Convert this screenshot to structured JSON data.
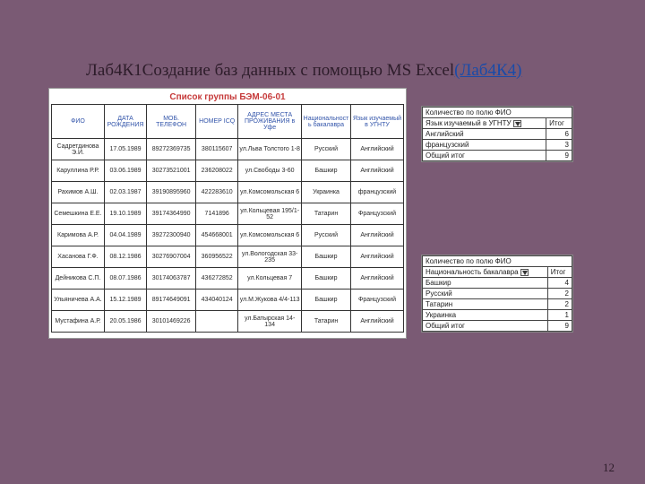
{
  "title": {
    "prefix": "Лаб4К1Создание баз данных с помощью MS Excel",
    "link": "(Лаб4К4)"
  },
  "list_title": "Список группы БЭМ-06-01",
  "main_headers": [
    "ФИО",
    "ДАТА РОЖДЕНИЯ",
    "МОБ. ТЕЛЕФОН",
    "НОМЕР ICQ",
    "АДРЕС МЕСТА ПРОЖИВАНИЯ в Уфе",
    "Национальность бакалавра",
    "Язык изучаемый в УГНТУ"
  ],
  "rows": [
    [
      "Садретдинова Э.И.",
      "17.05.1989",
      "89272369735",
      "380115607",
      "ул.Льва Толстого 1-8",
      "Русский",
      "Английский"
    ],
    [
      "Каруллина Р.Р.",
      "03.06.1989",
      "30273521001",
      "236208022",
      "ул.Свободы 3-60",
      "Башкир",
      "Английский"
    ],
    [
      "Рахимов А.Ш.",
      "02.03.1987",
      "39190895960",
      "422283610",
      "ул.Комсомольская 6",
      "Украинка",
      "французский"
    ],
    [
      "Семешкина Е.Е.",
      "19.10.1989",
      "39174364990",
      "7141896",
      "ул.Кольцевая 195/1-52",
      "Татарин",
      "Французский"
    ],
    [
      "Каримова А.Р.",
      "04.04.1989",
      "39272300940",
      "454668001",
      "ул.Комсомольская 6",
      "Русский",
      "Английский"
    ],
    [
      "Хасанова Г.Ф.",
      "08.12.1986",
      "30276907004",
      "360956522",
      "ул.Вологодская 33-235",
      "Башкир",
      "Английский"
    ],
    [
      "Дейникова С.П.",
      "08.07.1986",
      "30174063787",
      "436272852",
      "ул.Кольцевая 7",
      "Башкир",
      "Английский"
    ],
    [
      "Ульяничева А.А.",
      "15.12.1989",
      "89174649091",
      "434040124",
      "ул.М.Жукова 4/4-113",
      "Башкир",
      "Французский"
    ],
    [
      "Мустафина А.Р.",
      "20.05.1986",
      "30101469226",
      "",
      "ул.Батырская 14-134",
      "Татарин",
      "Английский"
    ]
  ],
  "pivot1": {
    "header": "Количество по полю ФИО",
    "group_label": "Язык изучаемый в УГНТУ",
    "value_label": "Итог",
    "rows": [
      [
        "Английский",
        "6"
      ],
      [
        "французский",
        "3"
      ],
      [
        "Общий итог",
        "9"
      ]
    ]
  },
  "pivot2": {
    "header": "Количество по полю ФИО",
    "group_label": "Национальность бакалавра",
    "value_label": "Итог",
    "rows": [
      [
        "Башкир",
        "4"
      ],
      [
        "Русский",
        "2"
      ],
      [
        "Татарин",
        "2"
      ],
      [
        "Украинка",
        "1"
      ],
      [
        "Общий итог",
        "9"
      ]
    ]
  },
  "page_number": "12"
}
